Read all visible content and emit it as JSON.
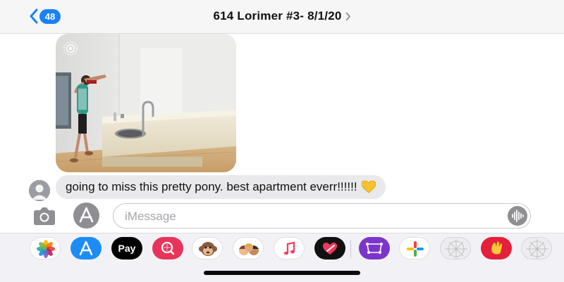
{
  "header": {
    "back_badge": "48",
    "title": "614 Lorimer #3- 8/1/20"
  },
  "photo": {
    "icon": "live-photo-icon"
  },
  "message": {
    "text": "going to miss this pretty pony. best apartment everr!!!!!!",
    "emoji": "yellow-heart-icon"
  },
  "input": {
    "placeholder": "iMessage",
    "value": ""
  },
  "app_drawer": {
    "apps": [
      {
        "name": "photos-app-icon"
      },
      {
        "name": "app-store-app-icon"
      },
      {
        "name": "apple-pay-app-icon",
        "label": "Pay"
      },
      {
        "name": "search-images-app-icon"
      },
      {
        "name": "animoji-app-icon"
      },
      {
        "name": "memoji-stickers-app-icon"
      },
      {
        "name": "music-app-icon"
      },
      {
        "name": "digital-touch-app-icon"
      },
      {
        "name": "photo-editor-app-icon"
      },
      {
        "name": "multicolor-app-icon"
      },
      {
        "name": "placeholder-app-icon"
      },
      {
        "name": "clap-app-icon"
      },
      {
        "name": "placeholder-app-icon-2"
      }
    ]
  },
  "colors": {
    "accent": "#1a82f7",
    "bubble": "#e9e9eb",
    "header_bg": "#f6f6f7",
    "drawer_bg": "#f2f2f6"
  }
}
